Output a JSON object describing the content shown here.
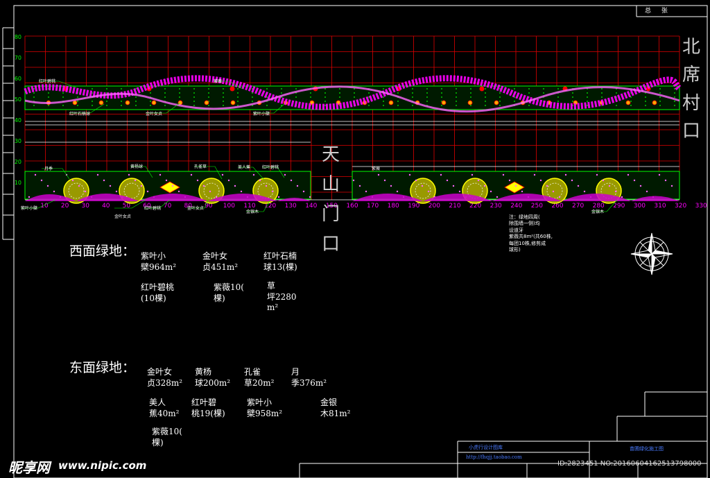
{
  "header": {
    "sheet_title": "总 张"
  },
  "signs": {
    "north": [
      "北",
      "席",
      "村",
      "口"
    ],
    "gate": [
      "天",
      "山",
      "门",
      "口"
    ]
  },
  "axis_ticks": {
    "top_y": [
      "80",
      "70",
      "60",
      "50",
      "40",
      "30",
      "20",
      "10"
    ],
    "bottom_x": [
      "10",
      "20",
      "30",
      "40",
      "50",
      "60",
      "70",
      "80",
      "90",
      "100",
      "110",
      "120",
      "130",
      "140",
      "150",
      "160",
      "170",
      "180",
      "190",
      "200",
      "210",
      "220",
      "230",
      "240",
      "250",
      "260",
      "270",
      "280",
      "290",
      "300",
      "310",
      "320",
      "330"
    ]
  },
  "callouts": {
    "top": [
      "红叶碧桃",
      "紫薇",
      "红叶石楠球",
      "金叶女贞",
      "紫叶小檗"
    ],
    "mid": [
      "月季",
      "黄杨球",
      "孔雀草",
      "美人蕉",
      "红叶碧桃"
    ],
    "bottom": [
      "紫叶小檗",
      "金叶女贞",
      "红叶碧桃",
      "金叶女贞",
      "金银木",
      "金银木"
    ],
    "tiny": [
      "紫薇"
    ]
  },
  "note": "注：绿地四周(\n除围墙一侧)均\n设道牙\n紫薇共8m²(共60株,\n每团10株,修剪成\n球形)",
  "west": {
    "title": "西面绿地：",
    "items": [
      "紫叶小\n檗964m²",
      "金叶女\n贞451m²",
      "红叶石楠\n球13(棵)",
      "红叶碧桃\n(10棵)",
      "紫薇10(\n棵)",
      "草\n坪2280\nm²"
    ]
  },
  "east": {
    "title": "东面绿地：",
    "items": [
      "金叶女\n贞328m²",
      "黄杨\n球200m²",
      "孔雀\n草20m²",
      "月\n季376m²",
      "美人\n蕉40m²",
      "红叶碧\n桃19(棵)",
      "紫叶小\n檗958m²",
      "金银\n木81m²",
      "紫薇10(\n棵)"
    ]
  },
  "title_block": {
    "company": "小虎行设计图库",
    "url": "http://fhqjj.taobao.com",
    "project": "苗圃绿化施工图"
  },
  "watermark": {
    "brand": "昵享网",
    "url": "www.nipic.com",
    "id_line": "ID:2823451 NO:20160604162513798000"
  },
  "colors": {
    "grid": "#e00000",
    "green": "#00ff00",
    "magenta": "#ff00ff",
    "yellow": "#ffff00",
    "white": "#ffffff"
  }
}
